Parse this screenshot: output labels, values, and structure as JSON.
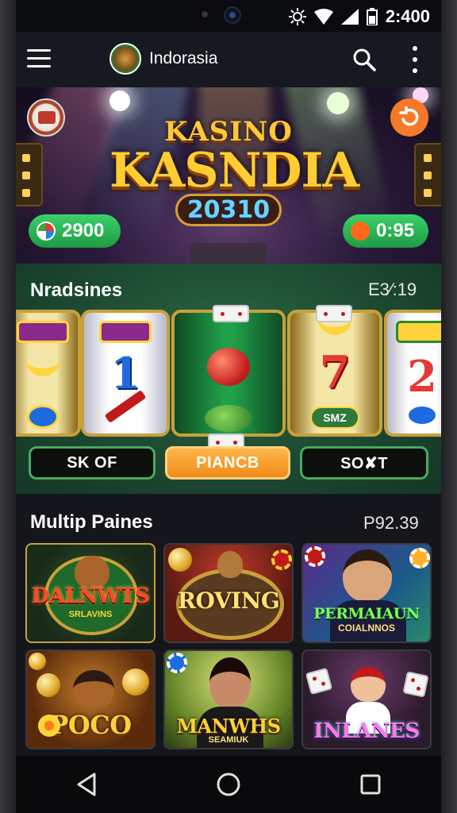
{
  "status": {
    "time": "2:400"
  },
  "app": {
    "title": "Indorasia"
  },
  "banner": {
    "title_top": "KASINO",
    "title_main": "KASNDIA",
    "year": "20310",
    "balance": "2900",
    "timer": "0:95"
  },
  "slots": {
    "title": "Nradsines",
    "value": "E3⁄:19",
    "reel_badge": "SMZ",
    "buttons": [
      "SK OF",
      "PIANCB",
      "SO✘T"
    ]
  },
  "multi": {
    "title": "Multip Paines",
    "value": "P92.39",
    "games": [
      {
        "title": "DALNWTS",
        "subtitle": "SRLAVINS"
      },
      {
        "title": "ROVING",
        "subtitle": ""
      },
      {
        "title": "PERMAIAUN",
        "subtitle": "COIALNNOS"
      },
      {
        "title": "POCO",
        "subtitle": ""
      },
      {
        "title": "MANWHS",
        "subtitle": "SEAMIUK"
      },
      {
        "title": "INLANES",
        "subtitle": ""
      }
    ]
  },
  "colors": {
    "accent_green": "#3bd16a",
    "accent_orange": "#f47a2a",
    "felt_green": "#1d4a32"
  }
}
